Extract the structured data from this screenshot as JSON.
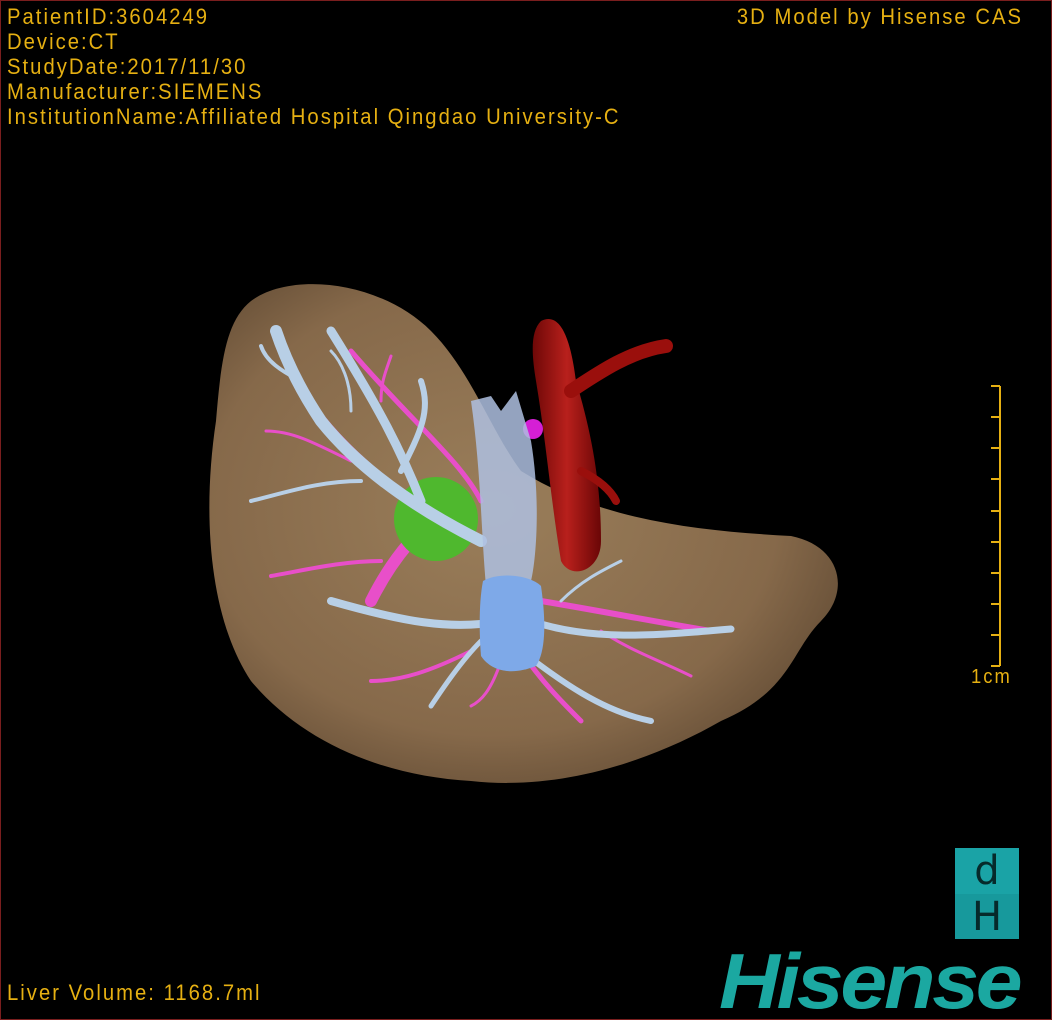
{
  "study_info": {
    "patient_id": "PatientID:3604249",
    "device": "Device:CT",
    "study_date": "StudyDate:2017/11/30",
    "manufacturer": "Manufacturer:SIEMENS",
    "institution": "InstitutionName:Affiliated Hospital Qingdao University-C"
  },
  "credit": "3D Model by Hisense CAS",
  "scale_bar": {
    "label": "1cm"
  },
  "liver_volume": "Liver Volume: 1168.7ml",
  "logo": {
    "box_top": "d",
    "box_bottom": "H",
    "brand": "Hisense"
  },
  "colors": {
    "overlay_text": "#e6b012",
    "liver": "#8b7150",
    "portal_vein": "#b8cfe6",
    "hepatic_vein": "#e84fc9",
    "aorta": "#a3100f",
    "vena_cava": "#7ea9e8",
    "tumor": "#4fb82e",
    "brand": "#1ba8a1",
    "border": "#7a1e1e"
  }
}
